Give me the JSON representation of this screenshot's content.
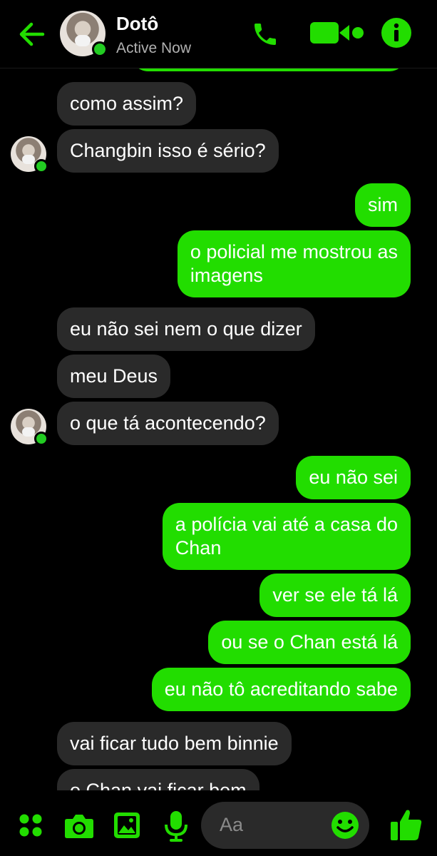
{
  "header": {
    "contact_name": "Dotô",
    "status": "Active Now"
  },
  "colors": {
    "accent": "#22dd00",
    "incoming_bubble": "#2a2a2a",
    "background": "#000000"
  },
  "icons": [
    "back-arrow-icon",
    "phone-icon",
    "video-camera-icon",
    "info-icon",
    "apps-icon",
    "camera-icon",
    "gallery-icon",
    "microphone-icon",
    "emoji-icon",
    "thumbs-up-icon"
  ],
  "messages": [
    {
      "dir": "in",
      "text": "como assim?"
    },
    {
      "dir": "in",
      "text": "Changbin isso é sério?"
    },
    {
      "dir": "out",
      "text": "sim"
    },
    {
      "dir": "out",
      "line1": "o policial me mostrou as",
      "line2": "imagens"
    },
    {
      "dir": "in",
      "text": "eu não sei nem o que dizer"
    },
    {
      "dir": "in",
      "text": "meu Deus"
    },
    {
      "dir": "in",
      "text": "o que tá acontecendo?"
    },
    {
      "dir": "out",
      "text": "eu não sei"
    },
    {
      "dir": "out",
      "line1": "a polícia vai até a casa do",
      "line2": "Chan"
    },
    {
      "dir": "out",
      "text": "ver se ele tá lá"
    },
    {
      "dir": "out",
      "text": "ou se o Chan está lá"
    },
    {
      "dir": "out",
      "text": "eu não tô acreditando sabe"
    },
    {
      "dir": "in",
      "text": "vai ficar tudo bem binnie"
    },
    {
      "dir": "in",
      "text": "o Chan vai ficar bem"
    }
  ],
  "composer": {
    "placeholder": "Aa"
  }
}
